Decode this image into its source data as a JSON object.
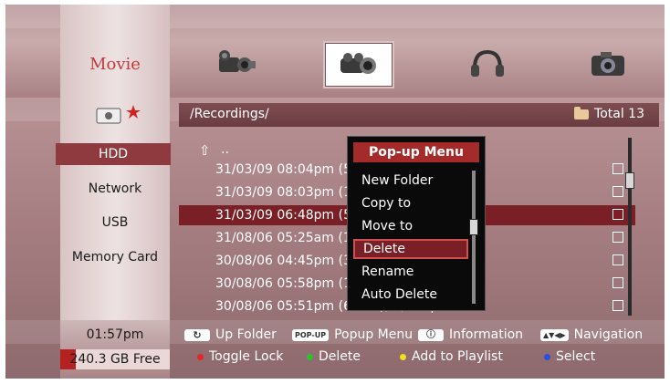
{
  "header": {
    "title": "Movie",
    "media_tabs": [
      {
        "icon": "camcorder-icon",
        "selected": false
      },
      {
        "icon": "film-projector-icon",
        "selected": true
      },
      {
        "icon": "headphones-icon",
        "selected": false
      },
      {
        "icon": "photo-camera-icon",
        "selected": false
      }
    ]
  },
  "path_bar": {
    "path": "/Recordings/",
    "total": "Total 13"
  },
  "sidebar": {
    "items": [
      {
        "label": "HDD",
        "active": true
      },
      {
        "label": "Network",
        "active": false
      },
      {
        "label": "USB",
        "active": false
      },
      {
        "label": "Memory Card",
        "active": false
      }
    ]
  },
  "file_list": {
    "parent": "..",
    "rows": [
      {
        "label": "31/03/09 08:04pm (5",
        "selected": false
      },
      {
        "label": "31/03/09 08:03pm (1",
        "selected": false
      },
      {
        "label": "31/03/09 06:48pm (5",
        "selected": true
      },
      {
        "label": "31/08/06 05:25am (1",
        "selected": false
      },
      {
        "label": "30/08/06 04:45pm (3                       MIC",
        "selected": false
      },
      {
        "label": "30/08/06 05:58pm (1",
        "selected": false
      },
      {
        "label": "30/08/06 05:51pm (6 min), A/V Input",
        "selected": false
      }
    ]
  },
  "popup": {
    "title": "Pop-up Menu",
    "items": [
      "New Folder",
      "Copy to",
      "Move to",
      "Delete",
      "Rename",
      "Auto Delete"
    ],
    "active_index": 3
  },
  "status": {
    "time": "01:57pm",
    "free": "240.3 GB Free",
    "used_fraction": 0.14
  },
  "help": {
    "row1": [
      {
        "key": "↻",
        "label": "Up Folder"
      },
      {
        "key": "POP-UP",
        "label": "Popup Menu"
      },
      {
        "key": "ⓘ",
        "label": "Information"
      },
      {
        "key": "▲▼◀▶",
        "label": "Navigation"
      }
    ],
    "row2": [
      {
        "color": "#e02828",
        "label": "Toggle Lock"
      },
      {
        "color": "#2fbf2f",
        "label": "Delete"
      },
      {
        "color": "#f0e020",
        "label": "Add to Playlist"
      },
      {
        "color": "#2a4ee0",
        "label": "Select"
      }
    ]
  }
}
